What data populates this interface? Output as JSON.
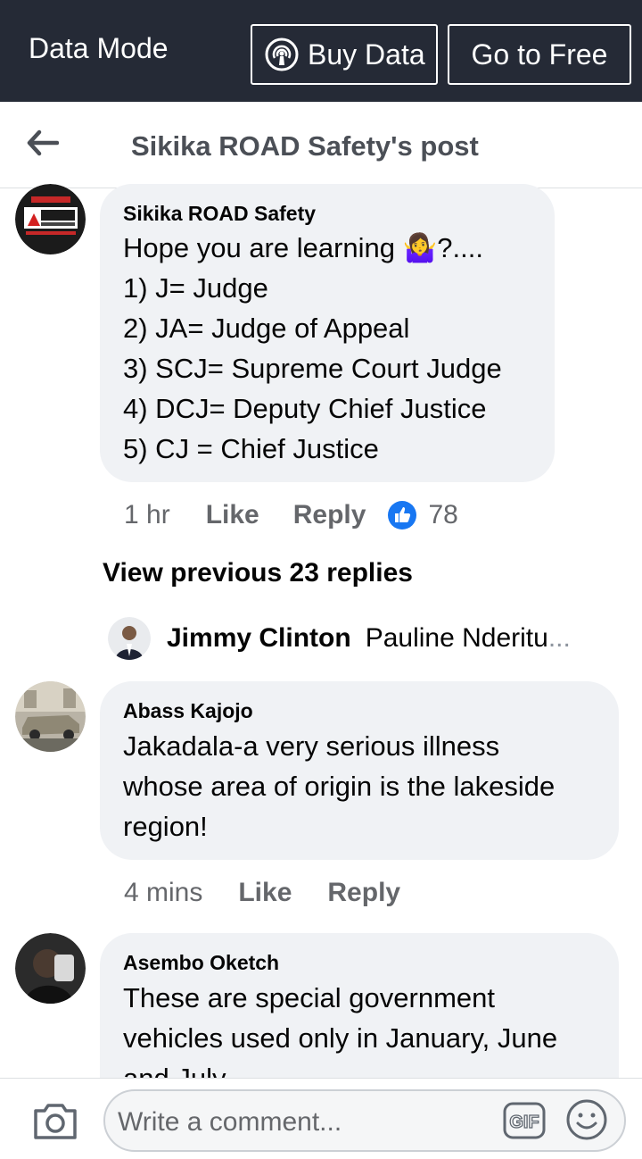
{
  "datamode": {
    "title": "Data Mode",
    "buy_label": "Buy Data",
    "free_label": "Go to Free"
  },
  "header": {
    "title": "Sikika ROAD Safety's post"
  },
  "comments": [
    {
      "author": "Sikika ROAD Safety",
      "lines": [
        "Hope you are learning 🤷‍♀️?....",
        "1) J= Judge",
        "2) JA= Judge of Appeal",
        "3) SCJ= Supreme Court Judge",
        "4) DCJ= Deputy Chief Justice",
        "5) CJ = Chief Justice"
      ],
      "time": "1 hr",
      "like_label": "Like",
      "reply_label": "Reply",
      "reaction_count": "78"
    },
    {
      "author": "Abass Kajojo",
      "lines": [
        "Jakadala-a very serious illness",
        "whose area of origin is the lakeside",
        "region!"
      ],
      "time": "4 mins",
      "like_label": "Like",
      "reply_label": "Reply"
    },
    {
      "author": "Asembo Oketch",
      "lines": [
        "These are special government",
        "vehicles used only in January, June",
        "and July"
      ]
    }
  ],
  "replies": {
    "view_previous_label": "View previous 23 replies",
    "latest_name": "Jimmy Clinton",
    "latest_text": "Pauline Nderitu",
    "latest_ellipsis": "..."
  },
  "composer": {
    "placeholder": "Write a comment...",
    "gif_label": "GIF"
  },
  "colors": {
    "topbar": "#252a36",
    "bubble": "#f0f2f5",
    "like_blue": "#1877f2",
    "meta_gray": "#65676b"
  },
  "icons": [
    "back-arrow-icon",
    "broadcast-icon",
    "like-reaction-icon",
    "camera-icon",
    "gif-icon",
    "emoji-icon"
  ]
}
